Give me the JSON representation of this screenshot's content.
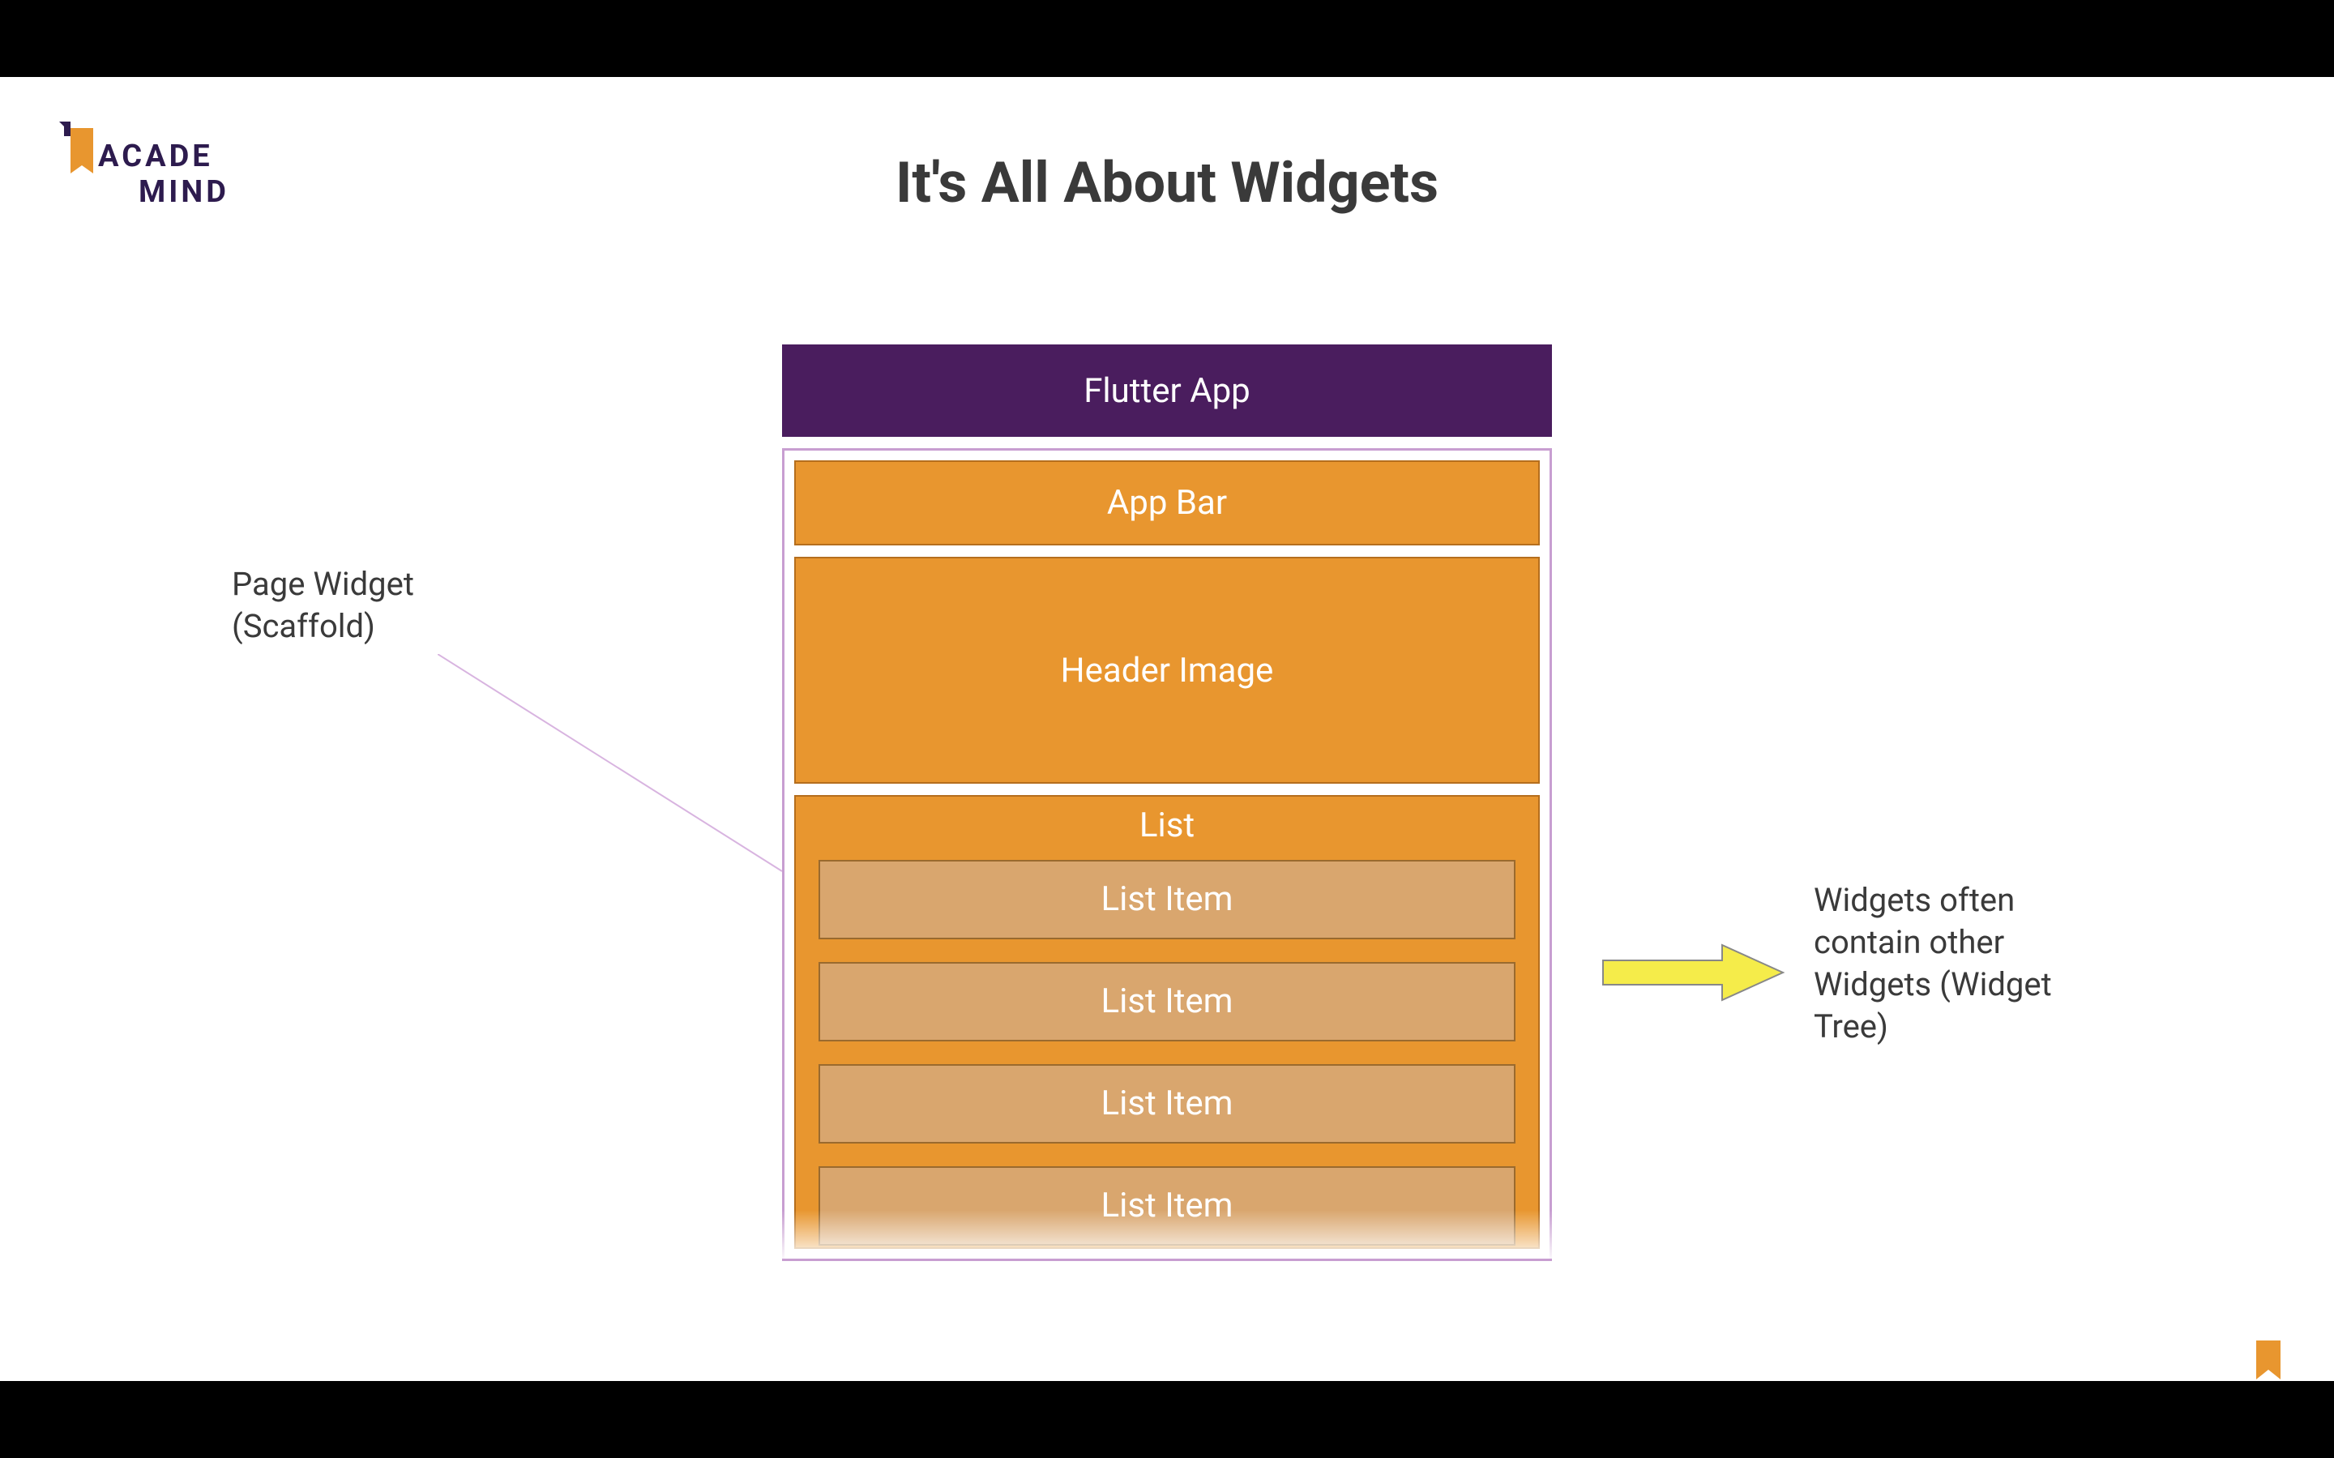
{
  "logo": {
    "line1": "ACADE",
    "line2": "MIND"
  },
  "title": "It's All About Widgets",
  "diagram": {
    "flutterApp": "Flutter App",
    "appBar": "App Bar",
    "headerImage": "Header Image",
    "list": "List",
    "listItems": [
      "List Item",
      "List Item",
      "List Item",
      "List Item"
    ]
  },
  "annotations": {
    "left": {
      "line1": "Page Widget",
      "line2": "(Scaffold)"
    },
    "right": "Widgets often contain other Widgets (Widget Tree)"
  },
  "colors": {
    "purple": "#4a1d5e",
    "orange": "#e8962f",
    "lightOrange": "#d9a66e",
    "borderPurple": "#c89ed1",
    "textDark": "#3a3a3a",
    "logoPurple": "#2d1b4e",
    "arrowYellow": "#f5ec4a"
  }
}
